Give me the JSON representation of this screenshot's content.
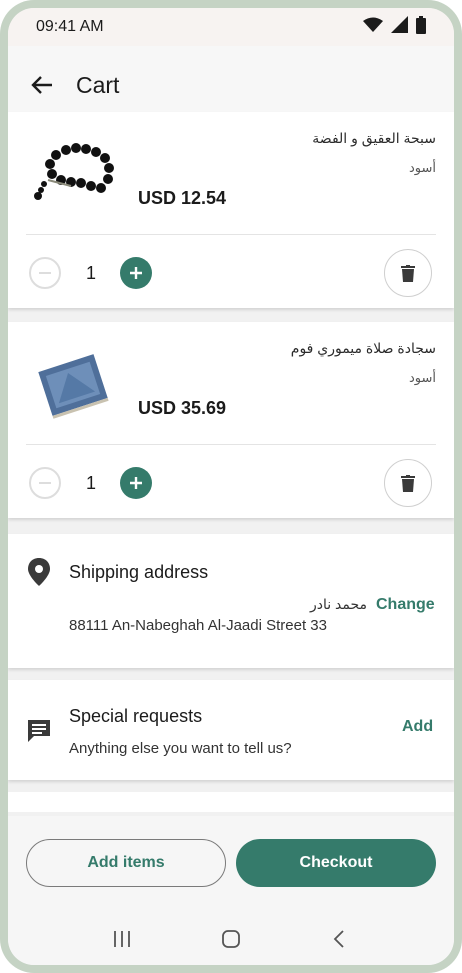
{
  "status_bar": {
    "time": "09:41 AM",
    "icons": [
      "wifi-icon",
      "signal-icon",
      "battery-icon"
    ]
  },
  "appbar": {
    "title": "Cart",
    "back_icon": "arrow-left-icon"
  },
  "cart_items": [
    {
      "name": "سبحة العقيق و الفضة",
      "variant": "أسود",
      "price": "USD 12.54",
      "quantity": "1",
      "image": "prayer-beads"
    },
    {
      "name": "سجادة صلاة ميموري فوم",
      "variant": "أسود",
      "price": "USD 35.69",
      "quantity": "1",
      "image": "prayer-rug"
    }
  ],
  "shipping": {
    "title": "Shipping address",
    "recipient": "محمد نادر",
    "address": "88111 An-Nabeghah Al-Jaadi Street 33",
    "action": "Change"
  },
  "special_requests": {
    "title": "Special requests",
    "subtitle": "Anything else you want to tell us?",
    "action": "Add"
  },
  "actions": {
    "add_items": "Add items",
    "checkout": "Checkout"
  },
  "colors": {
    "accent": "#357b6b",
    "background": "#f1f1f1",
    "card": "#ffffff",
    "frame": "#c5d3c4"
  }
}
